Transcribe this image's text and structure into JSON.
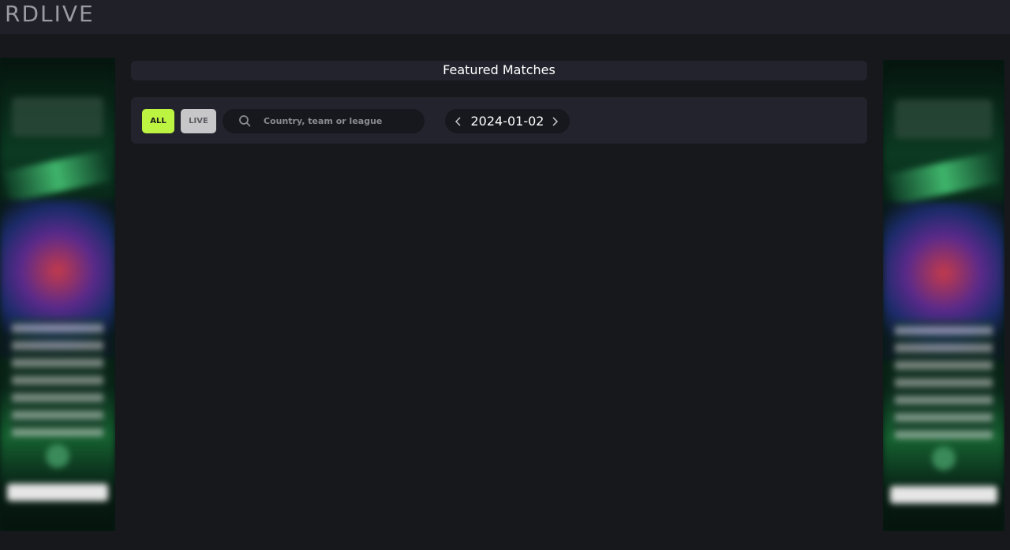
{
  "header": {
    "logo_text": "RDLIVE"
  },
  "main": {
    "section_title": "Featured Matches",
    "filters": {
      "all_label": "ALL",
      "live_label": "LIVE",
      "active": "ALL"
    },
    "search": {
      "placeholder": "Country, team or league",
      "value": ""
    },
    "date_picker": {
      "date": "2024-01-02"
    }
  },
  "colors": {
    "accent": "#bdf441",
    "background": "#17181c",
    "panel": "#22232c",
    "topbar": "#202028"
  },
  "icons": [
    "search-icon",
    "chevron-left-icon",
    "chevron-right-icon"
  ]
}
